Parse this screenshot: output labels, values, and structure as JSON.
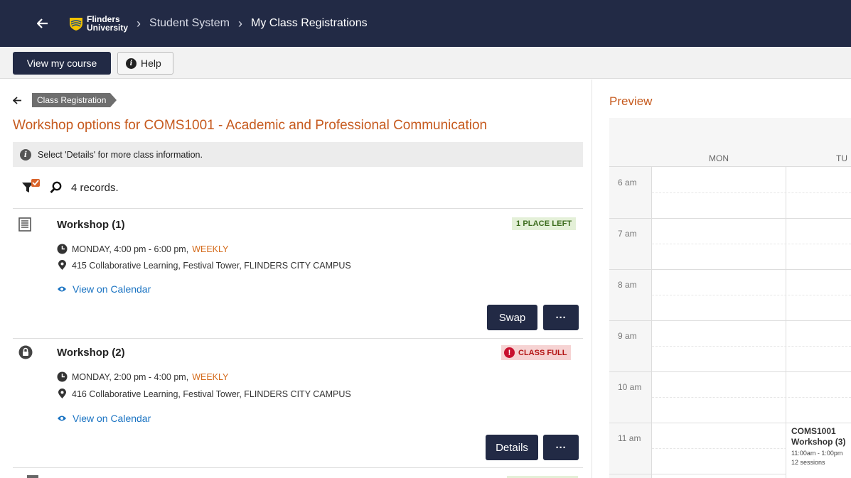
{
  "nav": {
    "logo_line1": "Flinders",
    "logo_line2": "University",
    "breadcrumbs": [
      "Student System",
      "My Class Registrations"
    ]
  },
  "toolbar": {
    "view_course": "View my course",
    "help": "Help"
  },
  "left": {
    "tag": "Class Registration",
    "title": "Workshop options for COMS1001 - Academic and Professional Communication",
    "info": "Select 'Details' for more class information.",
    "records": "4 records."
  },
  "cards": [
    {
      "title": "Workshop (1)",
      "badge": "1 PLACE LEFT",
      "time": "MONDAY, 4:00 pm - 6:00 pm,",
      "frequency": "WEEKLY",
      "location": "415 Collaborative Learning, Festival Tower, FLINDERS CITY CAMPUS",
      "calendar_link": "View on Calendar",
      "action": "Swap",
      "more": "···"
    },
    {
      "title": "Workshop (2)",
      "badge": "CLASS FULL",
      "time": "MONDAY, 2:00 pm - 4:00 pm,",
      "frequency": "WEEKLY",
      "location": "416 Collaborative Learning, Festival Tower, FLINDERS CITY CAMPUS",
      "calendar_link": "View on Calendar",
      "action": "Details",
      "more": "···"
    }
  ],
  "preview": {
    "title": "Preview",
    "days": [
      "MON",
      "TU"
    ],
    "hours": [
      "6 am",
      "7 am",
      "8 am",
      "9 am",
      "10 am",
      "11 am"
    ],
    "event": {
      "code": "COMS1001",
      "name": "Workshop (3)",
      "time": "11:00am - 1:00pm",
      "sessions": "12 sessions"
    }
  },
  "colors": {
    "nav_bg": "#222a45",
    "accent_orange": "#c65a1e",
    "link_blue": "#1a73c2",
    "badge_green_bg": "#e4f0d8",
    "badge_red_bg": "#f6d3d3"
  }
}
